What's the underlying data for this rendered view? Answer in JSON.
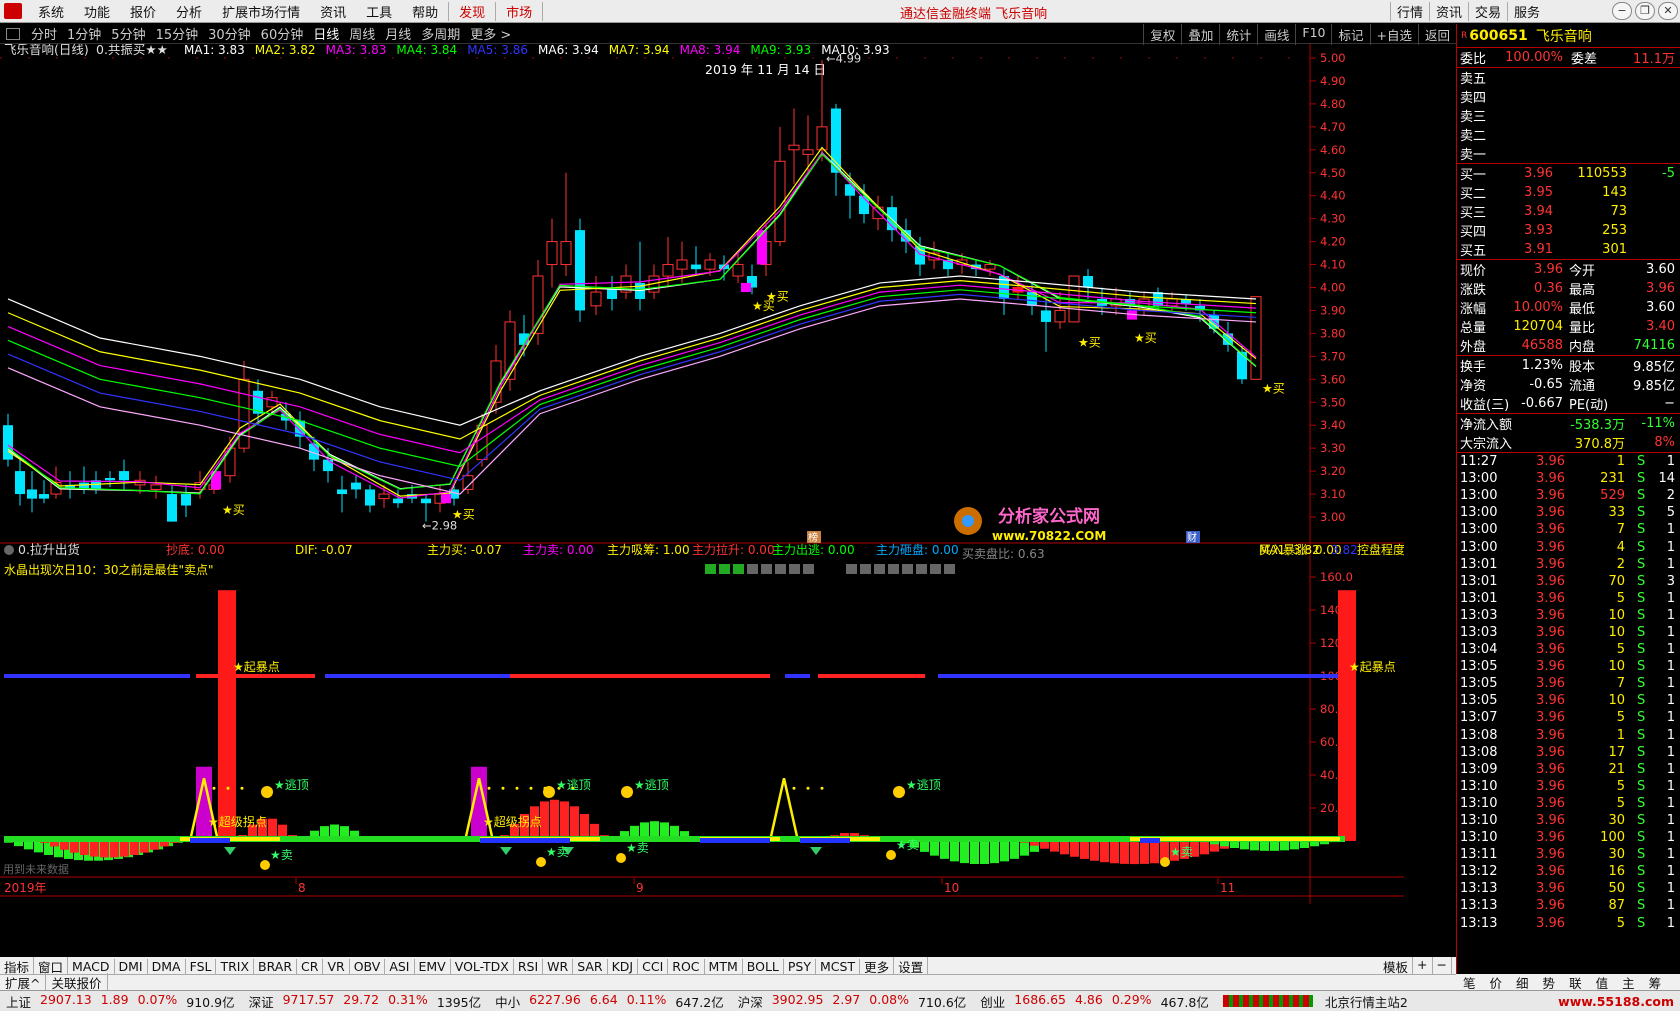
{
  "menu": {
    "items": [
      "系统",
      "功能",
      "报价",
      "分析",
      "扩展市场行情",
      "资讯",
      "工具",
      "帮助"
    ],
    "highlight1": "发现",
    "highlight2": "市场",
    "title": "通达信金融终端  飞乐音响",
    "right_items": [
      "行情",
      "资讯",
      "交易",
      "服务"
    ]
  },
  "periods": [
    "分时",
    "1分钟",
    "5分钟",
    "15分钟",
    "30分钟",
    "60分钟",
    "日线",
    "周线",
    "月线",
    "多周期",
    "更多 >"
  ],
  "toolbar_right": [
    "复权",
    "叠加",
    "统计",
    "画线",
    "F10",
    "标记",
    "+自选",
    "返回"
  ],
  "main_chart": {
    "title": "飞乐音响(日线)",
    "indicator": "0.共振买★★",
    "ma": [
      {
        "label": "MA1: 3.83",
        "color": "#ffffff"
      },
      {
        "label": "MA2: 3.82",
        "color": "#ffff00"
      },
      {
        "label": "MA3: 3.83",
        "color": "#ff00ff"
      },
      {
        "label": "MA4: 3.84",
        "color": "#00ff00"
      },
      {
        "label": "MA5: 3.86",
        "color": "#3333ff"
      },
      {
        "label": "MA6: 3.94",
        "color": "#ffffff"
      },
      {
        "label": "MA7: 3.94",
        "color": "#ffff00"
      },
      {
        "label": "MA8: 3.94",
        "color": "#ff00ff"
      },
      {
        "label": "MA9: 3.93",
        "color": "#00ff00"
      },
      {
        "label": "MA10: 3.93",
        "color": "#ffffff"
      }
    ],
    "date": "2019 年 11 月 14 日",
    "high_label": "4.99",
    "low_label": "2.98",
    "price_ticks": [
      "5.00",
      "4.90",
      "4.80",
      "4.70",
      "4.60",
      "4.50",
      "4.40",
      "4.30",
      "4.20",
      "4.10",
      "4.00",
      "3.90",
      "3.80",
      "3.70",
      "3.60",
      "3.50",
      "3.40",
      "3.30",
      "3.20",
      "3.10",
      "3.00"
    ],
    "buy_label": "★买",
    "bang": "榜",
    "cai": "财",
    "watermark": "分析家公式网",
    "watermark_url": "www.70822.COM"
  },
  "sub_chart": {
    "title": "0.拉升出货",
    "values": [
      {
        "label": "抄底: 0.00",
        "color": "#ff3333"
      },
      {
        "label": "DIF: -0.07",
        "color": "#ffee00"
      },
      {
        "label": "主力买: -0.07",
        "color": "#ffee00"
      },
      {
        "label": "主力卖: 0.00",
        "color": "#ff00ff"
      },
      {
        "label": "主力吸筹: 1.00",
        "color": "#ffee00"
      },
      {
        "label": "主力拉升: 0.00",
        "color": "#ff3333"
      },
      {
        "label": "主力出逃: 0.00",
        "color": "#00ff00"
      },
      {
        "label": "主力砸盘: 0.00",
        "color": "#00aaff"
      },
      {
        "label": "买入暴涨: 0.00",
        "color": "#ffee00"
      },
      {
        "label": "买卖盘比: 0.63",
        "color": "#888888"
      },
      {
        "label": "MA1: 3.82",
        "color": "#ffee00"
      },
      {
        "label": "3.82",
        "color": "#3333ff"
      },
      {
        "label": "控盘程度",
        "color": "#ffee00"
      }
    ],
    "note": "水晶出现次日10：30之前是最佳\"卖点\"",
    "ticks": [
      "160.0",
      "140.0",
      "120.0",
      "100.0",
      "80.00",
      "60.00",
      "40.00",
      "20.00"
    ],
    "label_qibao": "★起暴点",
    "label_chaoji": "★超级拐点",
    "label_xuanding": "★逃顶",
    "label_mai": "★卖",
    "footer_left": "用到未来数据"
  },
  "xaxis": {
    "year": "2019年",
    "months": [
      "8",
      "9",
      "10",
      "11"
    ],
    "period": "日线"
  },
  "indicator_tabs": [
    "指标",
    "窗口",
    "MACD",
    "DMI",
    "DMA",
    "FSL",
    "TRIX",
    "BRAR",
    "CR",
    "VR",
    "OBV",
    "ASI",
    "EMV",
    "VOL-TDX",
    "RSI",
    "WR",
    "SAR",
    "KDJ",
    "CCI",
    "ROC",
    "MTM",
    "BOLL",
    "PSY",
    "MCST",
    "更多",
    "设置"
  ],
  "tab_right": [
    "模板",
    "+",
    "−"
  ],
  "bottom_tabs2": [
    "扩展^",
    "关联报价"
  ],
  "quote": {
    "code": "600651",
    "name": "飞乐音响",
    "webi_label": "委比",
    "webi": "100.00%",
    "weicha_label": "委差",
    "weicha": "11.1万",
    "sell": [
      "卖五",
      "卖四",
      "卖三",
      "卖二",
      "卖一"
    ],
    "buy": [
      {
        "label": "买一",
        "price": "3.96",
        "vol": "110553",
        "chg": "-5"
      },
      {
        "label": "买二",
        "price": "3.95",
        "vol": "143",
        "chg": ""
      },
      {
        "label": "买三",
        "price": "3.94",
        "vol": "73",
        "chg": ""
      },
      {
        "label": "买四",
        "price": "3.93",
        "vol": "253",
        "chg": ""
      },
      {
        "label": "买五",
        "price": "3.91",
        "vol": "301",
        "chg": ""
      }
    ],
    "stats": [
      {
        "l1": "现价",
        "v1": "3.96",
        "l2": "今开",
        "v2": "3.60"
      },
      {
        "l1": "涨跌",
        "v1": "0.36",
        "l2": "最高",
        "v2": "3.96"
      },
      {
        "l1": "涨幅",
        "v1": "10.00%",
        "l2": "最低",
        "v2": "3.60"
      },
      {
        "l1": "总量",
        "v1": "120704",
        "l2": "量比",
        "v2": "3.40"
      },
      {
        "l1": "外盘",
        "v1": "46588",
        "l2": "内盘",
        "v2": "74116"
      }
    ],
    "stats2": [
      {
        "l1": "换手",
        "v1": "1.23%",
        "l2": "股本",
        "v2": "9.85亿"
      },
      {
        "l1": "净资",
        "v1": "-0.65",
        "l2": "流通",
        "v2": "9.85亿"
      },
      {
        "l1": "收益(三)",
        "v1": "-0.667",
        "l2": "PE(动)",
        "v2": "−"
      }
    ],
    "flow": [
      {
        "label": "净流入额",
        "v1": "-538.3万",
        "v2": "-11%"
      },
      {
        "label": "大宗流入",
        "v1": "370.8万",
        "v2": "8%"
      }
    ],
    "ticks": [
      {
        "t": "11:27",
        "p": "3.96",
        "v": "1",
        "s": "S",
        "n": "1"
      },
      {
        "t": "13:00",
        "p": "3.96",
        "v": "231",
        "s": "S",
        "n": "14"
      },
      {
        "t": "13:00",
        "p": "3.96",
        "v": "529",
        "s": "S",
        "n": "2"
      },
      {
        "t": "13:00",
        "p": "3.96",
        "v": "33",
        "s": "S",
        "n": "5"
      },
      {
        "t": "13:00",
        "p": "3.96",
        "v": "7",
        "s": "S",
        "n": "1"
      },
      {
        "t": "13:00",
        "p": "3.96",
        "v": "4",
        "s": "S",
        "n": "1"
      },
      {
        "t": "13:01",
        "p": "3.96",
        "v": "2",
        "s": "S",
        "n": "1"
      },
      {
        "t": "13:01",
        "p": "3.96",
        "v": "70",
        "s": "S",
        "n": "3"
      },
      {
        "t": "13:01",
        "p": "3.96",
        "v": "5",
        "s": "S",
        "n": "1"
      },
      {
        "t": "13:03",
        "p": "3.96",
        "v": "10",
        "s": "S",
        "n": "1"
      },
      {
        "t": "13:03",
        "p": "3.96",
        "v": "10",
        "s": "S",
        "n": "1"
      },
      {
        "t": "13:04",
        "p": "3.96",
        "v": "5",
        "s": "S",
        "n": "1"
      },
      {
        "t": "13:05",
        "p": "3.96",
        "v": "10",
        "s": "S",
        "n": "1"
      },
      {
        "t": "13:05",
        "p": "3.96",
        "v": "7",
        "s": "S",
        "n": "1"
      },
      {
        "t": "13:05",
        "p": "3.96",
        "v": "10",
        "s": "S",
        "n": "1"
      },
      {
        "t": "13:07",
        "p": "3.96",
        "v": "5",
        "s": "S",
        "n": "1"
      },
      {
        "t": "13:08",
        "p": "3.96",
        "v": "1",
        "s": "S",
        "n": "1"
      },
      {
        "t": "13:08",
        "p": "3.96",
        "v": "17",
        "s": "S",
        "n": "1"
      },
      {
        "t": "13:09",
        "p": "3.96",
        "v": "21",
        "s": "S",
        "n": "1"
      },
      {
        "t": "13:10",
        "p": "3.96",
        "v": "5",
        "s": "S",
        "n": "1"
      },
      {
        "t": "13:10",
        "p": "3.96",
        "v": "5",
        "s": "S",
        "n": "1"
      },
      {
        "t": "13:10",
        "p": "3.96",
        "v": "30",
        "s": "S",
        "n": "1"
      },
      {
        "t": "13:10",
        "p": "3.96",
        "v": "100",
        "s": "S",
        "n": "1"
      },
      {
        "t": "13:11",
        "p": "3.96",
        "v": "30",
        "s": "S",
        "n": "1"
      },
      {
        "t": "13:12",
        "p": "3.96",
        "v": "16",
        "s": "S",
        "n": "1"
      },
      {
        "t": "13:13",
        "p": "3.96",
        "v": "50",
        "s": "S",
        "n": "1"
      },
      {
        "t": "13:13",
        "p": "3.96",
        "v": "87",
        "s": "S",
        "n": "1"
      },
      {
        "t": "13:13",
        "p": "3.96",
        "v": "5",
        "s": "S",
        "n": "1"
      }
    ],
    "tabs": [
      "笔",
      "价",
      "细",
      "势",
      "联",
      "值",
      "主",
      "筹"
    ]
  },
  "status": [
    {
      "name": "上证",
      "val": "2907.13",
      "chg": "1.89",
      "pct": "0.07%",
      "amt": "910.9亿"
    },
    {
      "name": "深证",
      "val": "9717.57",
      "chg": "29.72",
      "pct": "0.31%",
      "amt": "1395亿"
    },
    {
      "name": "中小",
      "val": "6227.96",
      "chg": "6.64",
      "pct": "0.11%",
      "amt": "647.2亿"
    },
    {
      "name": "沪深",
      "val": "3902.95",
      "chg": "2.97",
      "pct": "0.08%",
      "amt": "710.6亿"
    },
    {
      "name": "创业",
      "val": "1686.65",
      "chg": "4.86",
      "pct": "0.29%",
      "amt": "467.8亿"
    }
  ],
  "status_right": "北京行情主站2",
  "site": "www.55188.com",
  "colors": {
    "up": "#ff3333",
    "down": "#00e5ff",
    "bg": "#000000",
    "axis": "#b00000"
  }
}
